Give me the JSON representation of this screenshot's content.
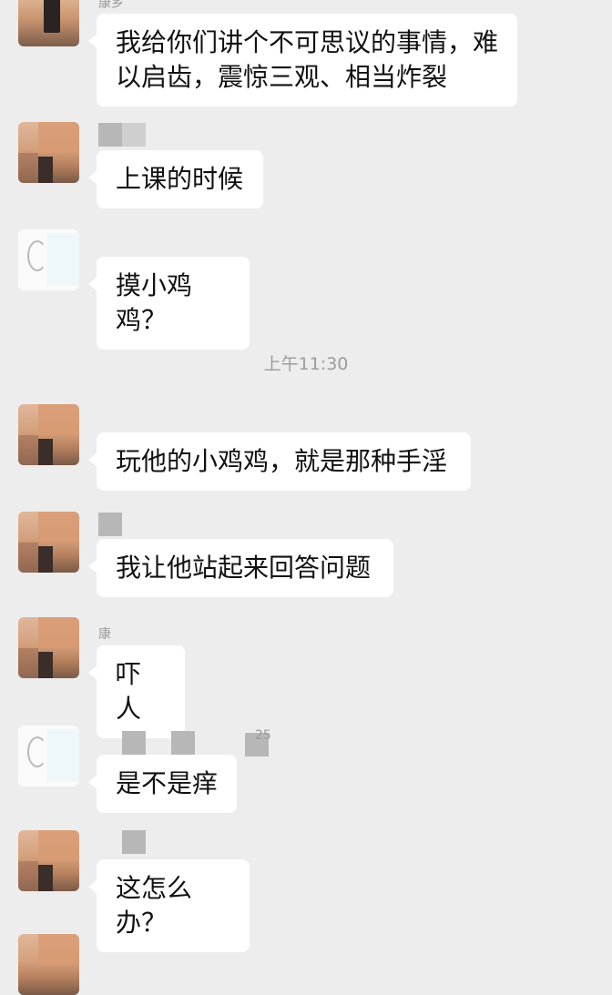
{
  "chat": {
    "timestamp": "上午11:30",
    "partial_names": [
      "康乡",
      "康",
      "25"
    ],
    "messages": [
      {
        "text": "我给你们讲个不可思议的事情，难以启齿，震惊三观、相当炸裂"
      },
      {
        "text": "上课的时候"
      },
      {
        "text": "摸小鸡鸡？"
      },
      {
        "text": "玩他的小鸡鸡，就是那种手淫"
      },
      {
        "text": "我让他站起来回答问题"
      },
      {
        "text": "吓人"
      },
      {
        "text": "是不是痒"
      },
      {
        "text": "这怎么办？"
      }
    ]
  },
  "colors": {
    "background": "#ededed",
    "bubble": "#ffffff",
    "text": "#111111",
    "timestamp": "#9c9c9c"
  }
}
